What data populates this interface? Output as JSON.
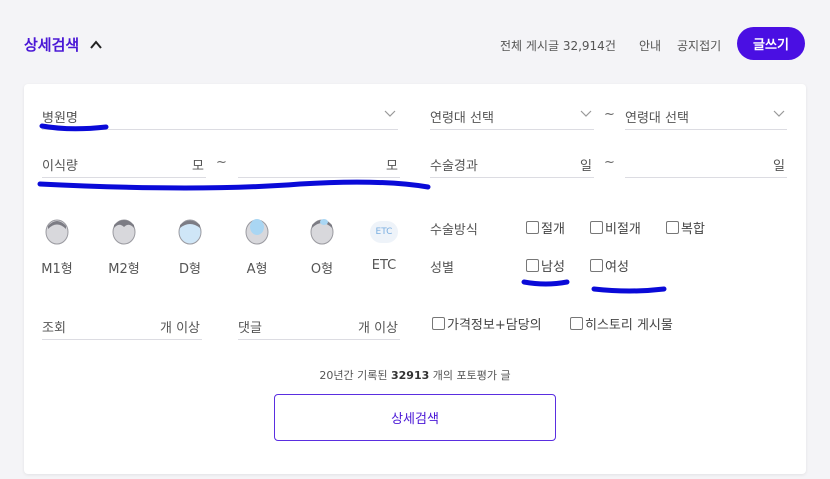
{
  "header": {
    "title": "상세검색",
    "total_posts": "전체 게시글 32,914건",
    "notice": "안내",
    "fold_notice": "공지접기",
    "write_button": "글쓰기"
  },
  "filters": {
    "hospital": "병원명",
    "age_from": "연령대 선택",
    "age_to": "연령대 선택",
    "tilde": "~",
    "graft_label": "이식량",
    "graft_unit_from": "모",
    "graft_unit_to": "모",
    "surgery_period_label": "수술경과",
    "period_unit_from": "일",
    "period_unit_to": "일"
  },
  "hair_types": [
    {
      "label": "M1형",
      "icon": "m1-head-icon"
    },
    {
      "label": "M2형",
      "icon": "m2-head-icon"
    },
    {
      "label": "D형",
      "icon": "d-head-icon"
    },
    {
      "label": "A형",
      "icon": "a-head-icon"
    },
    {
      "label": "O형",
      "icon": "o-head-icon"
    },
    {
      "label": "ETC",
      "icon": "etc-icon",
      "badge": "ETC"
    }
  ],
  "method": {
    "label": "수술방식",
    "options": [
      "절개",
      "비절개",
      "복합"
    ]
  },
  "gender": {
    "label": "성별",
    "options": [
      "남성",
      "여성"
    ]
  },
  "views": {
    "label": "조회",
    "unit": "개 이상"
  },
  "comments": {
    "label": "댓글",
    "unit": "개 이상"
  },
  "extra_options": [
    "가격정보+담당의",
    "히스토리 게시물"
  ],
  "summary": {
    "prefix": "20년간 기록된",
    "count": "32913",
    "suffix": "개의 포토평가 글"
  },
  "search_button": "상세검색",
  "colors": {
    "accent": "#4a0fe3",
    "annotation": "#0a0ad8"
  }
}
